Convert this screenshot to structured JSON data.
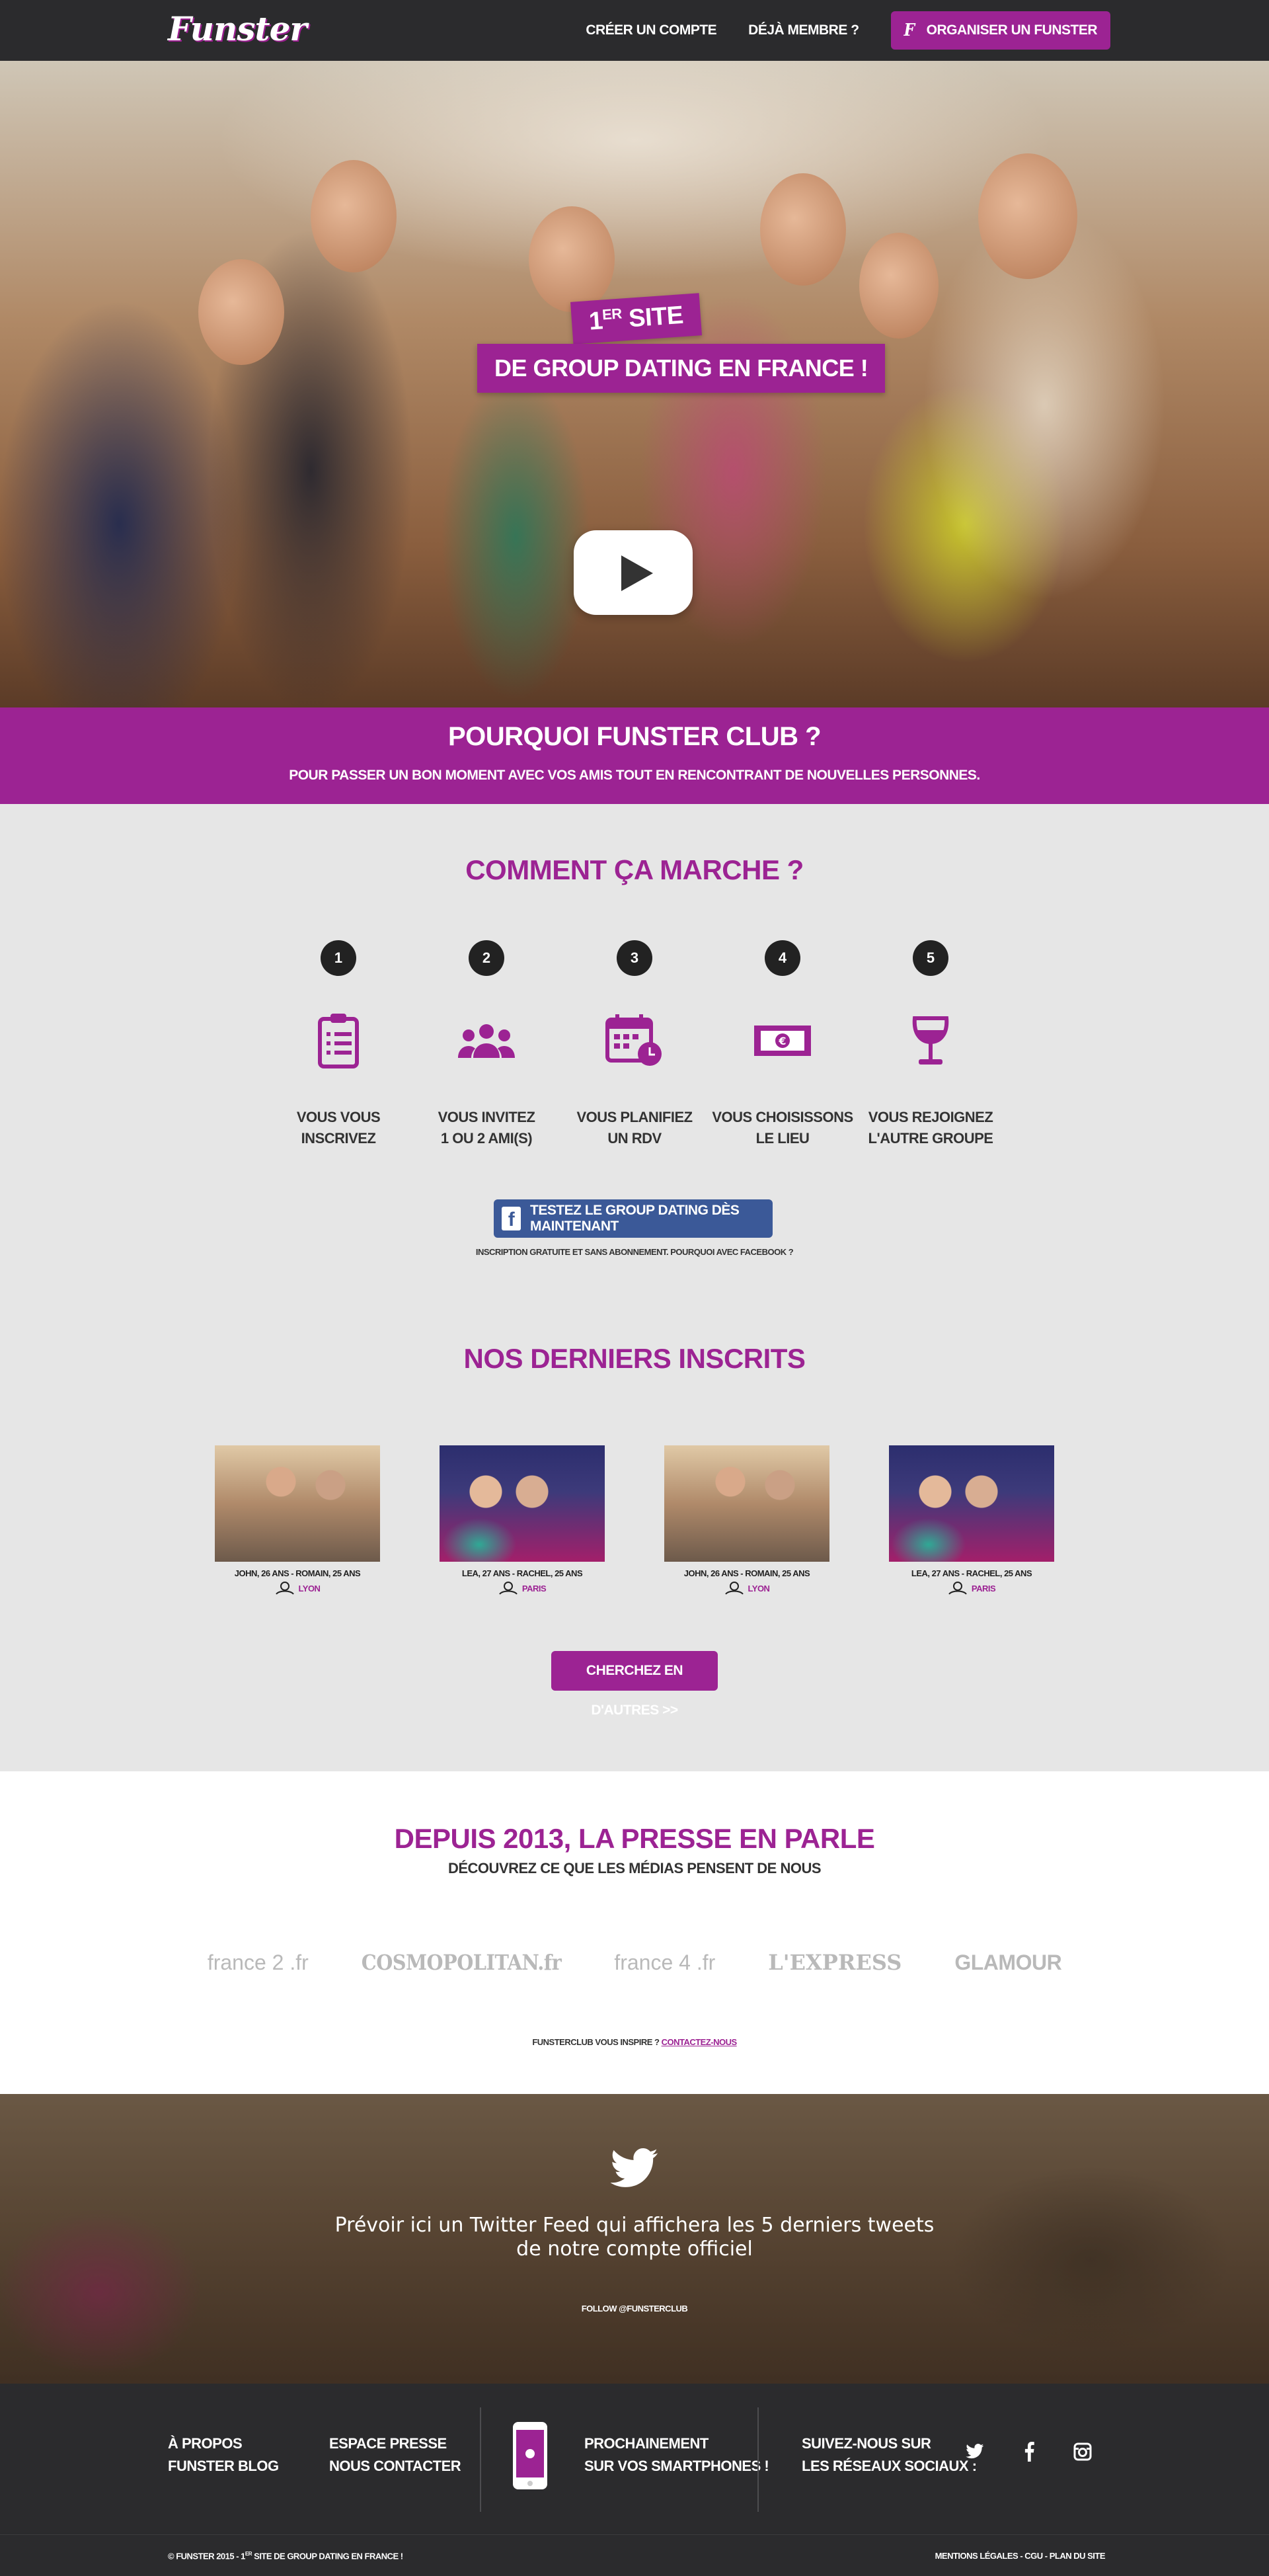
{
  "header": {
    "logo": "Funster",
    "nav": {
      "create_account": "CRÉER UN COMPTE",
      "already_member": "DÉJÀ MEMBRE ?",
      "organize_badge": "F",
      "organize": "ORGANISER UN FUNSTER"
    }
  },
  "hero": {
    "badge_line1_main": "1",
    "badge_line1_sup": "ER",
    "badge_line1_rest": " SITE",
    "badge_line2": "DE GROUP DATING EN FRANCE !"
  },
  "why": {
    "title": "POURQUOI FUNSTER CLUB ?",
    "subtitle": "POUR PASSER UN BON MOMENT AVEC VOS AMIS TOUT EN RENCONTRANT DE NOUVELLES PERSONNES."
  },
  "how": {
    "title": "COMMENT ÇA MARCHE ?",
    "steps": [
      {
        "num": "1",
        "label_line1": "VOUS VOUS",
        "label_line2": "INSCRIVEZ",
        "icon": "clipboard-icon"
      },
      {
        "num": "2",
        "label_line1": "VOUS INVITEZ",
        "label_line2": "1 OU 2 AMI(S)",
        "icon": "group-icon"
      },
      {
        "num": "3",
        "label_line1": "VOUS PLANIFIEZ",
        "label_line2": "UN RDV",
        "icon": "calendar-icon"
      },
      {
        "num": "4",
        "label_line1": "VOUS CHOISISSONS",
        "label_line2": "LE LIEU",
        "icon": "banknote-icon"
      },
      {
        "num": "5",
        "label_line1": "VOUS REJOIGNEZ",
        "label_line2": "L'AUTRE GROUPE",
        "icon": "wine-glass-icon"
      }
    ],
    "fb_button": "TESTEZ LE GROUP DATING DÈS MAINTENANT",
    "fb_note": "INSCRIPTION GRATUITE ET SANS ABONNEMENT. POURQUOI AVEC FACEBOOK ?"
  },
  "latest": {
    "title": "NOS DERNIERS INSCRITS",
    "members": [
      {
        "names": "JOHN, 26 ANS - ROMAIN, 25 ANS",
        "city": "LYON"
      },
      {
        "names": "LEA, 27 ANS - RACHEL, 25 ANS",
        "city": "PARIS"
      },
      {
        "names": "JOHN, 26 ANS - ROMAIN, 25 ANS",
        "city": "LYON"
      },
      {
        "names": "LEA, 27 ANS - RACHEL, 25 ANS",
        "city": "PARIS"
      }
    ],
    "more_button": "CHERCHEZ EN D'AUTRES >>"
  },
  "press": {
    "title": "DEPUIS 2013, LA PRESSE EN PARLE",
    "subtitle": "DÉCOUVREZ CE QUE LES MÉDIAS PENSENT DE NOUS",
    "logos": [
      "france 2 .fr",
      "COSMOPOLITAN.fr",
      "france 4 .fr",
      "L'EXPRESS",
      "GLAMOUR"
    ],
    "footer_text": "FUNSTERCLUB VOUS INSPIRE ? ",
    "contact_link": "CONTACTEZ-NOUS"
  },
  "twitter": {
    "feed_line1": "Prévoir ici un Twitter Feed qui affichera les 5 derniers tweets",
    "feed_line2": "de notre compte officiel",
    "follow": "FOLLOW @FUNSTERCLUB"
  },
  "footer": {
    "about": "À PROPOS",
    "blog": "FUNSTER BLOG",
    "press": "ESPACE PRESSE",
    "contact": "NOUS CONTACTER",
    "soon_line1": "PROCHAINEMENT",
    "soon_line2": "SUR VOS SMARTPHONES !",
    "social_line1": "SUIVEZ-NOUS SUR",
    "social_line2": "LES RÉSEAUX SOCIAUX :",
    "copyright_main": "© FUNSTER 2015 - 1",
    "copyright_sup": "ER",
    "copyright_rest": " SITE DE GROUP DATING EN FRANCE !",
    "legal": "MENTIONS LÉGALES - CGU - PLAN DU SITE"
  },
  "colors": {
    "brand_purple": "#9c2393",
    "dark_bar": "#2b2b2d",
    "facebook_blue": "#3b5998",
    "section_gray": "#e6e6e6"
  }
}
